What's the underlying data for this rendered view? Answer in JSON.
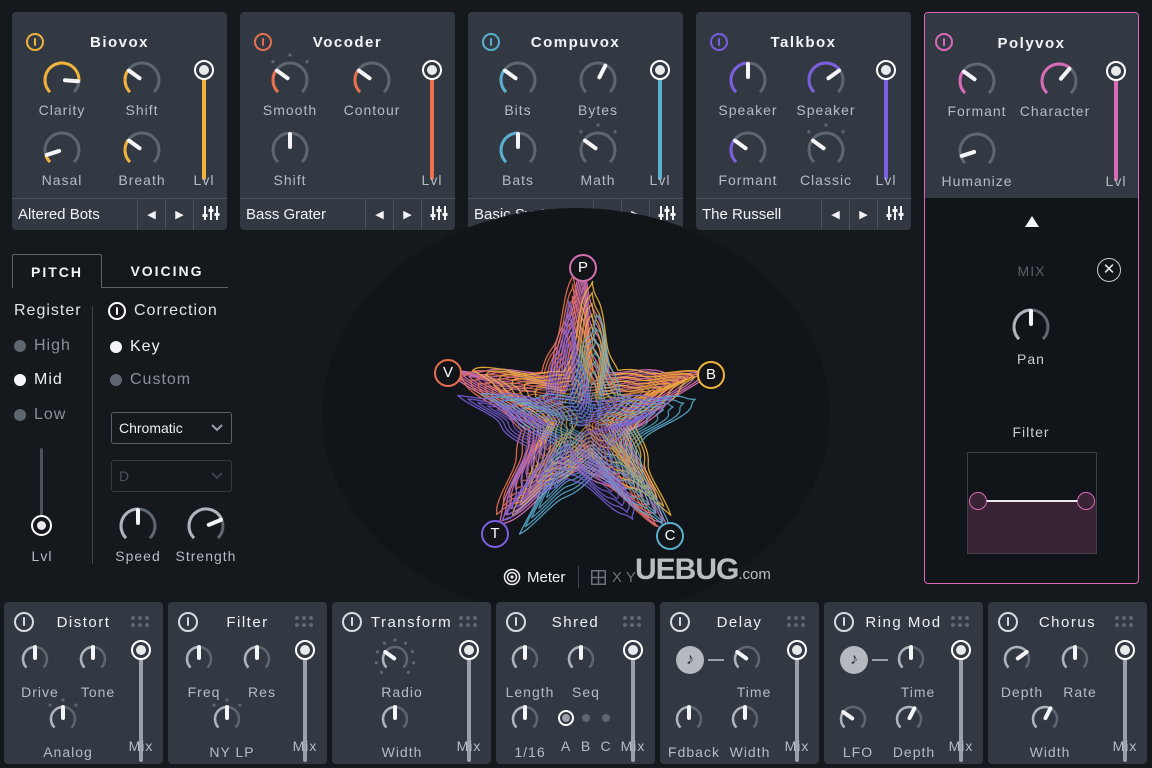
{
  "colors": {
    "biovox": "#f0b43c",
    "vocoder": "#e8704f",
    "compuvox": "#5aaed0",
    "talkbox": "#7b5fe0",
    "polyvox": "#d96ab9",
    "panel_bg": "#323942",
    "app_bg": "#15181d"
  },
  "modules": [
    {
      "id": "biovox",
      "title": "Biovox",
      "enabled": true,
      "knobs": [
        {
          "label": "Clarity",
          "value": 0.85
        },
        {
          "label": "Shift",
          "value": 0.3
        },
        {
          "label": "Nasal",
          "value": 0.1
        },
        {
          "label": "Breath",
          "value": 0.3
        }
      ],
      "level_label": "Lvl",
      "level": 1.0,
      "preset": "Altered Bots"
    },
    {
      "id": "vocoder",
      "title": "Vocoder",
      "enabled": true,
      "knobs": [
        {
          "label": "Smooth",
          "value": 0.3
        },
        {
          "label": "Contour",
          "value": 0.3
        },
        {
          "label": "Shift",
          "value": 0.5
        }
      ],
      "level_label": "Lvl",
      "level": 1.0,
      "preset": "Bass Grater"
    },
    {
      "id": "compuvox",
      "title": "Compuvox",
      "enabled": true,
      "knobs": [
        {
          "label": "Bits",
          "value": 0.3
        },
        {
          "label": "Bytes",
          "value": 0.6
        },
        {
          "label": "Bats",
          "value": 0.5
        },
        {
          "label": "Math",
          "value": 0.3
        }
      ],
      "level_label": "Lvl",
      "level": 1.0,
      "preset": "Basic Syntax"
    },
    {
      "id": "talkbox",
      "title": "Talkbox",
      "enabled": true,
      "knobs": [
        {
          "label": "Speaker",
          "value": 0.5
        },
        {
          "label": "Speaker",
          "value": 0.7
        },
        {
          "label": "Formant",
          "value": 0.3
        },
        {
          "label": "Classic",
          "value": 0.3
        }
      ],
      "level_label": "Lvl",
      "level": 1.0,
      "preset": "The Russell"
    },
    {
      "id": "polyvox",
      "title": "Polyvox",
      "enabled": true,
      "knobs": [
        {
          "label": "Formant",
          "value": 0.3
        },
        {
          "label": "Character",
          "value": 0.65
        },
        {
          "label": "Humanize",
          "value": 0.1
        }
      ],
      "level_label": "Lvl",
      "level": 1.0
    }
  ],
  "polyvox_expanded": {
    "mix_label": "MIX",
    "pan_label": "Pan",
    "pan": 0.5,
    "filter_label": "Filter"
  },
  "pitch_section": {
    "tabs": [
      {
        "label": "PITCH",
        "active": true
      },
      {
        "label": "VOICING",
        "active": false
      }
    ],
    "register_label": "Register",
    "register_options": [
      {
        "label": "High",
        "selected": false
      },
      {
        "label": "Mid",
        "selected": true
      },
      {
        "label": "Low",
        "selected": false
      }
    ],
    "level_label": "Lvl",
    "level": 0.0,
    "correction_label": "Correction",
    "correction_options": [
      {
        "label": "Key",
        "selected": true
      },
      {
        "label": "Custom",
        "selected": false
      }
    ],
    "scale_select": "Chromatic",
    "key_select": "D",
    "key_select_disabled": true,
    "speed_label": "Speed",
    "speed": 0.5,
    "strength_label": "Strength",
    "strength": 0.75
  },
  "meter": {
    "nodes": [
      "P",
      "B",
      "C",
      "T",
      "V"
    ],
    "view_options": [
      {
        "label": "Meter",
        "icon": "concentric-circles-icon",
        "active": true
      },
      {
        "label": "X Y",
        "icon": "grid-icon",
        "active": false
      }
    ]
  },
  "watermark": {
    "text": "UEBUG",
    "suffix": ".com"
  },
  "effects": [
    {
      "title": "Distort",
      "knobs": [
        {
          "label": "Drive",
          "value": 0.5
        },
        {
          "label": "Tone",
          "value": 0.5
        },
        {
          "label": "Analog",
          "value": 0.5
        }
      ],
      "mix_label": "Mix",
      "mix": 1.0
    },
    {
      "title": "Filter",
      "knobs": [
        {
          "label": "Freq",
          "value": 0.5
        },
        {
          "label": "Res",
          "value": 0.5
        },
        {
          "label": "NY LP",
          "value": 0.5
        }
      ],
      "mix_label": "Mix",
      "mix": 1.0
    },
    {
      "title": "Transform",
      "knobs": [
        {
          "label": "Radio",
          "value": 0.3
        },
        {
          "label": "Width",
          "value": 0.5
        }
      ],
      "mix_label": "Mix",
      "mix": 1.0
    },
    {
      "title": "Shred",
      "knobs": [
        {
          "label": "Length",
          "value": 0.5
        },
        {
          "label": "Seq",
          "value": 0.5
        },
        {
          "label": "1/16",
          "value": 0.5
        }
      ],
      "patterns": [
        "A",
        "B",
        "C"
      ],
      "selected_pattern": "A",
      "mix_label": "Mix",
      "mix": 1.0
    },
    {
      "title": "Delay",
      "knobs": [
        {
          "label": "Time",
          "value": 0.3
        },
        {
          "label": "Fdback",
          "value": 0.5
        },
        {
          "label": "Width",
          "value": 0.5
        }
      ],
      "mix_label": "Mix",
      "mix": 1.0
    },
    {
      "title": "Ring Mod",
      "knobs": [
        {
          "label": "Time",
          "value": 0.5
        },
        {
          "label": "LFO",
          "value": 0.3
        },
        {
          "label": "Depth",
          "value": 0.6
        }
      ],
      "mix_label": "Mix",
      "mix": 1.0
    },
    {
      "title": "Chorus",
      "knobs": [
        {
          "label": "Depth",
          "value": 0.7
        },
        {
          "label": "Rate",
          "value": 0.5
        },
        {
          "label": "Width",
          "value": 0.6
        }
      ],
      "mix_label": "Mix",
      "mix": 1.0
    }
  ]
}
